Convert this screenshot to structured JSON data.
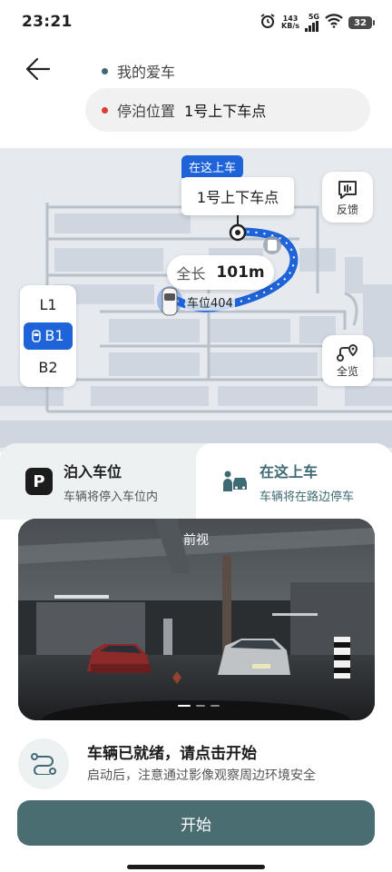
{
  "status_bar": {
    "time": "23:21",
    "net_speed_value": "143",
    "net_speed_unit": "KB/s",
    "signal_label": "5G",
    "battery": "32"
  },
  "header": {
    "vehicle_name": "我的爱车",
    "parking_label": "停泊位置",
    "parking_value": "1号上下车点"
  },
  "map": {
    "pickup_tag": "在这上车",
    "pickup_point": "1号上下车点",
    "distance_label": "全长",
    "distance_value": "101m",
    "spot_label": "车位404",
    "feedback_label": "反馈",
    "overview_label": "全览",
    "floors": [
      {
        "label": "L1",
        "active": false
      },
      {
        "label": "B1",
        "active": true
      },
      {
        "label": "B2",
        "active": false
      }
    ]
  },
  "modes": {
    "left": {
      "title": "泊入车位",
      "subtitle": "车辆将停入车位内"
    },
    "right": {
      "title": "在这上车",
      "subtitle": "车辆将在路边停车"
    }
  },
  "camera": {
    "label": "前视"
  },
  "status": {
    "title": "车辆已就绪，请点击开始",
    "subtitle": "启动后，注意通过影像观察周边环境安全"
  },
  "start_button": "开始",
  "colors": {
    "accent_blue": "#1f63d8",
    "primary_teal": "#4a6d72",
    "vehicle_dot": "#3e6b73",
    "parking_dot": "#e03a3a"
  }
}
